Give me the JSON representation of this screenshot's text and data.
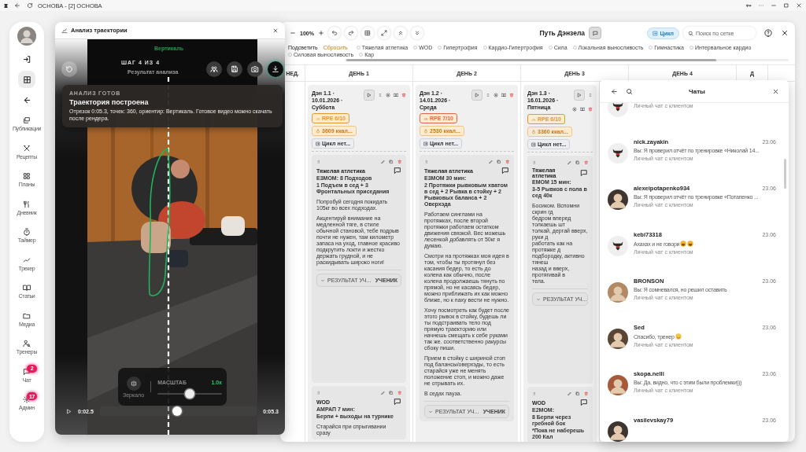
{
  "browser": {
    "title": "ОСНОВА - [2] ОСНОВА"
  },
  "sidebar": {
    "top_buttons": [
      {
        "kind": "logout",
        "selected": false
      },
      {
        "kind": "grid",
        "selected": true
      },
      {
        "kind": "back",
        "selected": false
      }
    ],
    "items": [
      {
        "kind": "publications",
        "label": "Публикации"
      },
      {
        "kind": "recipes",
        "label": "Рецепты"
      },
      {
        "kind": "plans",
        "label": "Планы"
      },
      {
        "kind": "diary",
        "label": "Дневник"
      },
      {
        "kind": "timer",
        "label": "Таймер"
      },
      {
        "kind": "tracker",
        "label": "Трекер"
      },
      {
        "kind": "articles",
        "label": "Статьи"
      },
      {
        "kind": "media",
        "label": "Медиа"
      },
      {
        "kind": "trainers",
        "label": "Тренеры"
      },
      {
        "kind": "chat",
        "label": "Чат",
        "badge": "2"
      },
      {
        "kind": "admin",
        "label": "Админ",
        "badge": "17"
      }
    ]
  },
  "analysis": {
    "title": "Анализ траектории",
    "guide_label": "Вертикаль",
    "step": "ШАГ 4 ИЗ 4",
    "step_title": "Результат анализа",
    "toast": {
      "label": "АНАЛИЗ ГОТОВ",
      "title": "Траектория построена",
      "text": "Отрезок 0:05.3, точек: 360, ориентир: Вертикаль. Готовое видео можно скачать после рендера."
    },
    "zoom": {
      "mirror_label": "Зеркало",
      "label": "МАСШТАБ",
      "value": "1.0x",
      "level": 0.5
    },
    "player": {
      "current": "0:02.5",
      "total": "0:05.3",
      "level": 0.49
    }
  },
  "planner": {
    "zoom": "100%",
    "title": "Путь Дэнзела",
    "cycle_button": "Цикл",
    "search": {
      "placeholder": "Поиск по сетке"
    },
    "highlight_label": "Подсветить",
    "reset_label": "Сбросить",
    "filters": [
      {
        "label": "Тяжелая атлетика",
        "checked": false
      },
      {
        "label": "WOD",
        "checked": false
      },
      {
        "label": "Гипертрофия",
        "checked": false
      },
      {
        "label": "Кардио-Гипертрофия",
        "checked": false
      },
      {
        "label": "Сила",
        "checked": false
      },
      {
        "label": "Локальная выносливость",
        "checked": false
      },
      {
        "label": "Гимнастика",
        "checked": false
      },
      {
        "label": "Интервальное кардио",
        "checked": false
      },
      {
        "label": "Силовая выносливость",
        "checked": false
      },
      {
        "label": "Кар",
        "checked": false
      }
    ],
    "week_label": "НЕД.",
    "day_headers": [
      "ДЕНЬ 1",
      "ДЕНЬ 2",
      "ДЕНЬ 3",
      "ДЕНЬ 4",
      "Д"
    ],
    "days": [
      {
        "title": "Дэн 1.1 · 10.01.2026 · Суббота",
        "chips": [
          {
            "kind": "rpe",
            "text": "RPE 6/10",
            "color": "#e29a2e"
          },
          {
            "kind": "energy",
            "text": "3609 ккал..."
          },
          {
            "kind": "cycle",
            "text": "Цикл нет..."
          }
        ],
        "blocks": [
          {
            "title": "Тяжелая атлетика",
            "items": [
              {
                "kind": "sub",
                "text": "E3MOM: 8 Подходов"
              },
              {
                "kind": "sub",
                "text": "1 Подъем в сед + 3 Фронтальных приседания"
              },
              {
                "kind": "text",
                "text": "Попробуй сегодня покидать 105кг во всех подходах."
              },
              {
                "kind": "text",
                "text": "Акцентируй внимание на медленной тяге, в стиле обычной становой, тебе подрыв почти не нужен, там километр запаса на уход, главное красиво подкрутить локти и жестко держать грудной, и не раскидывать широко ноги!"
              }
            ],
            "result": {
              "label": "РЕЗУЛЬТАТ УЧ...",
              "tag": "УЧЕНИК"
            }
          },
          {
            "title": "WOD",
            "items": [
              {
                "kind": "sub",
                "text": "АМРАП 7 мин:"
              },
              {
                "kind": "sub",
                "text": "Берпи + выходы на турнике"
              },
              {
                "kind": "text",
                "text": "Старайся при спрыгивании сразу"
              }
            ]
          }
        ]
      },
      {
        "title": "Дэн 1.2 · 14.01.2026 · Среда",
        "chips": [
          {
            "kind": "rpe",
            "text": "RPE 7/10",
            "color": "#e0674a"
          },
          {
            "kind": "energy",
            "text": "2530 ккал..."
          },
          {
            "kind": "cycle",
            "text": "Цикл нет..."
          }
        ],
        "blocks": [
          {
            "title": "Тяжелая атлетика",
            "items": [
              {
                "kind": "sub",
                "text": "E3MOM 30 мин:"
              },
              {
                "kind": "sub",
                "text": "2 Протяжки рывковым хватом в сед + 2 Рывка в стойку + 2 Рывковых баланса + 2 Оверхэда"
              },
              {
                "kind": "text",
                "text": "Работаем синглами на протяжках, после второй протяжки работаем остатком движения связкой. Вес можешь лесенкой добавлять от 50кг я думаю."
              },
              {
                "kind": "text",
                "text": "Смотри на протяжках моя идея в том, чтобы ты протянул без касания бедер, то есть до колена как обычно, после колена продолжаешь тянуть по прямой, но не касаясь бедер, можно приближать их как можно ближе, но к паху вести не нужно."
              },
              {
                "kind": "text",
                "text": "Хочу посмотреть как будет после этого рывок в стойку, будешь ли ты подстраивать тело под прямую траекторию или начнешь смещать к себе руками так же. соответственно ракурсы сбоку пиши."
              },
              {
                "kind": "text",
                "text": "Прием в стойку с шириной стоп под балансы/оверхэды, то есть старайся уже не менять положение стоп, и можно даже не отрывать их."
              },
              {
                "kind": "text",
                "text": "В седах пауза."
              }
            ],
            "result": {
              "label": "РЕЗУЛЬТАТ УЧ...",
              "tag": "УЧЕНИК"
            }
          }
        ]
      },
      {
        "title": "Дэн 1.3 · 16.01.2026 · Пятница",
        "chips": [
          {
            "kind": "rpe",
            "text": "RPE 6/10",
            "color": "#e29a2e"
          },
          {
            "kind": "energy",
            "text": "3360 ккал..."
          },
          {
            "kind": "cycle",
            "text": "Цикл нет..."
          }
        ],
        "blocks": [
          {
            "title": "Тяжелая атлетика",
            "items": [
              {
                "kind": "sub",
                "text": "EMOM 15 мин:"
              },
              {
                "kind": "sub-cut",
                "text": "3-5 Рывков с пола в сед 40к"
              },
              {
                "kind": "lines",
                "lines": [
                  "Босиком. Вспомни скрин гд",
                  "бедром вперед толкаешь шт",
                  "толкай, дергай вверх, руки д",
                  "работать как на протяжке д",
                  "подбородку, активно тянеш",
                  "назад и вверх, протягивай в",
                  "тела."
                ]
              }
            ],
            "result": {
              "label": "РЕЗУЛЬТАТ УЧ..."
            }
          },
          {
            "title": "WOD",
            "items": [
              {
                "kind": "sub",
                "text": "E2MOM:"
              },
              {
                "kind": "sub-cut",
                "text": "8 Берпи через гребной бок"
              },
              {
                "kind": "sub-cut",
                "text": "*Пока не наберешь 200 Кал"
              }
            ]
          }
        ]
      }
    ]
  },
  "chats": {
    "title": "Чаты",
    "items": [
      {
        "kind": "logo",
        "subtitle": "Личный чат с клиентом"
      },
      {
        "kind": "logo",
        "name": "nick.zayakin",
        "date": "23.06",
        "message": "Вы: Я проверил отчёт по тренировке «Николай 14...",
        "subtitle": "Личный чат с клиентом"
      },
      {
        "name": "alexeipotapenko934",
        "date": "23.06",
        "message": "Вы: Я проверил отчёт по тренировке «Потапенко ...",
        "subtitle": "Личный чат с клиентом"
      },
      {
        "kind": "logo",
        "name": "kebi73318",
        "date": "23.06",
        "message": "Ахахах и не говори",
        "emojis": [
          {
            "kind": "laugh"
          },
          {
            "kind": "laugh"
          }
        ],
        "subtitle": "Личный чат с клиентом"
      },
      {
        "name": "BRONSON",
        "date": "23.06",
        "message": "Вы: Я сомневался, но решил оставить",
        "subtitle": "Личный чат с клиентом"
      },
      {
        "name": "Sed",
        "date": "23.06",
        "message": "Спасибо, тренер",
        "emojis": [
          {
            "kind": "smile"
          }
        ],
        "subtitle": "Личный чат с клиентом"
      },
      {
        "name": "skopa.nelli",
        "date": "23.06",
        "message": "Вы: Да, видно, что с этим были проблемки)))",
        "subtitle": "Личный чат с клиентом"
      },
      {
        "name": "vasilevskay79",
        "date": "23.06"
      }
    ]
  }
}
